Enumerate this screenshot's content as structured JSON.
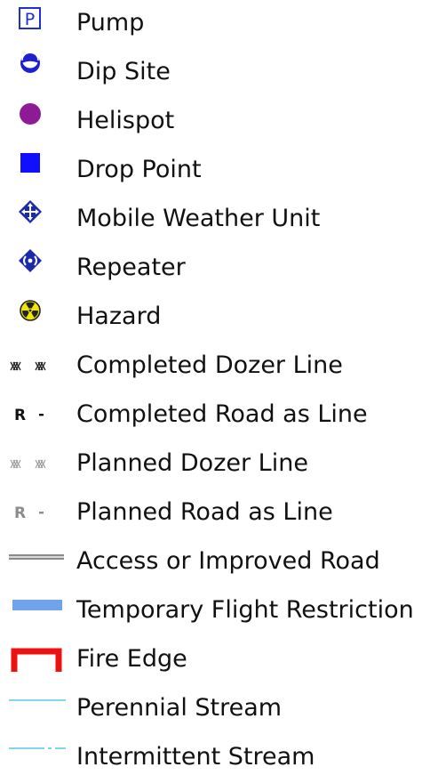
{
  "legend": {
    "items": [
      {
        "label": "Pump",
        "icon": "pump-icon",
        "color": "#1f2fd0"
      },
      {
        "label": "Dip Site",
        "icon": "dip-site-icon",
        "color": "#1f1fd0"
      },
      {
        "label": "Helispot",
        "icon": "helispot-icon",
        "color": "#8e1a96"
      },
      {
        "label": "Drop Point",
        "icon": "drop-point-icon",
        "color": "#1010ff"
      },
      {
        "label": "Mobile Weather Unit",
        "icon": "mobile-weather-unit-icon",
        "color": "#1a2aa8"
      },
      {
        "label": "Repeater",
        "icon": "repeater-icon",
        "color": "#1a2aa8"
      },
      {
        "label": "Hazard",
        "icon": "hazard-icon",
        "color": "#f2e600"
      },
      {
        "label": "Completed Dozer Line",
        "icon": "completed-dozer-line-icon",
        "color": "#222222"
      },
      {
        "label": "Completed Road as Line",
        "icon": "completed-road-line-icon",
        "color": "#111111"
      },
      {
        "label": "Planned Dozer Line",
        "icon": "planned-dozer-line-icon",
        "color": "#9a9a9a"
      },
      {
        "label": "Planned Road as Line",
        "icon": "planned-road-line-icon",
        "color": "#8c8c8c"
      },
      {
        "label": "Access or Improved Road",
        "icon": "access-road-icon",
        "color": "#8a8a8a"
      },
      {
        "label": "Temporary Flight Restriction",
        "icon": "tfr-icon",
        "color": "#6fa3ea"
      },
      {
        "label": "Fire Edge",
        "icon": "fire-edge-icon",
        "color": "#ee1111"
      },
      {
        "label": "Perennial Stream",
        "icon": "perennial-stream-icon",
        "color": "#7fd6ee"
      },
      {
        "label": "Intermittent Stream",
        "icon": "intermittent-stream-icon",
        "color": "#7fd6ee"
      }
    ],
    "symbol_text": {
      "pump_letter": "P",
      "road_letter": "R"
    }
  }
}
